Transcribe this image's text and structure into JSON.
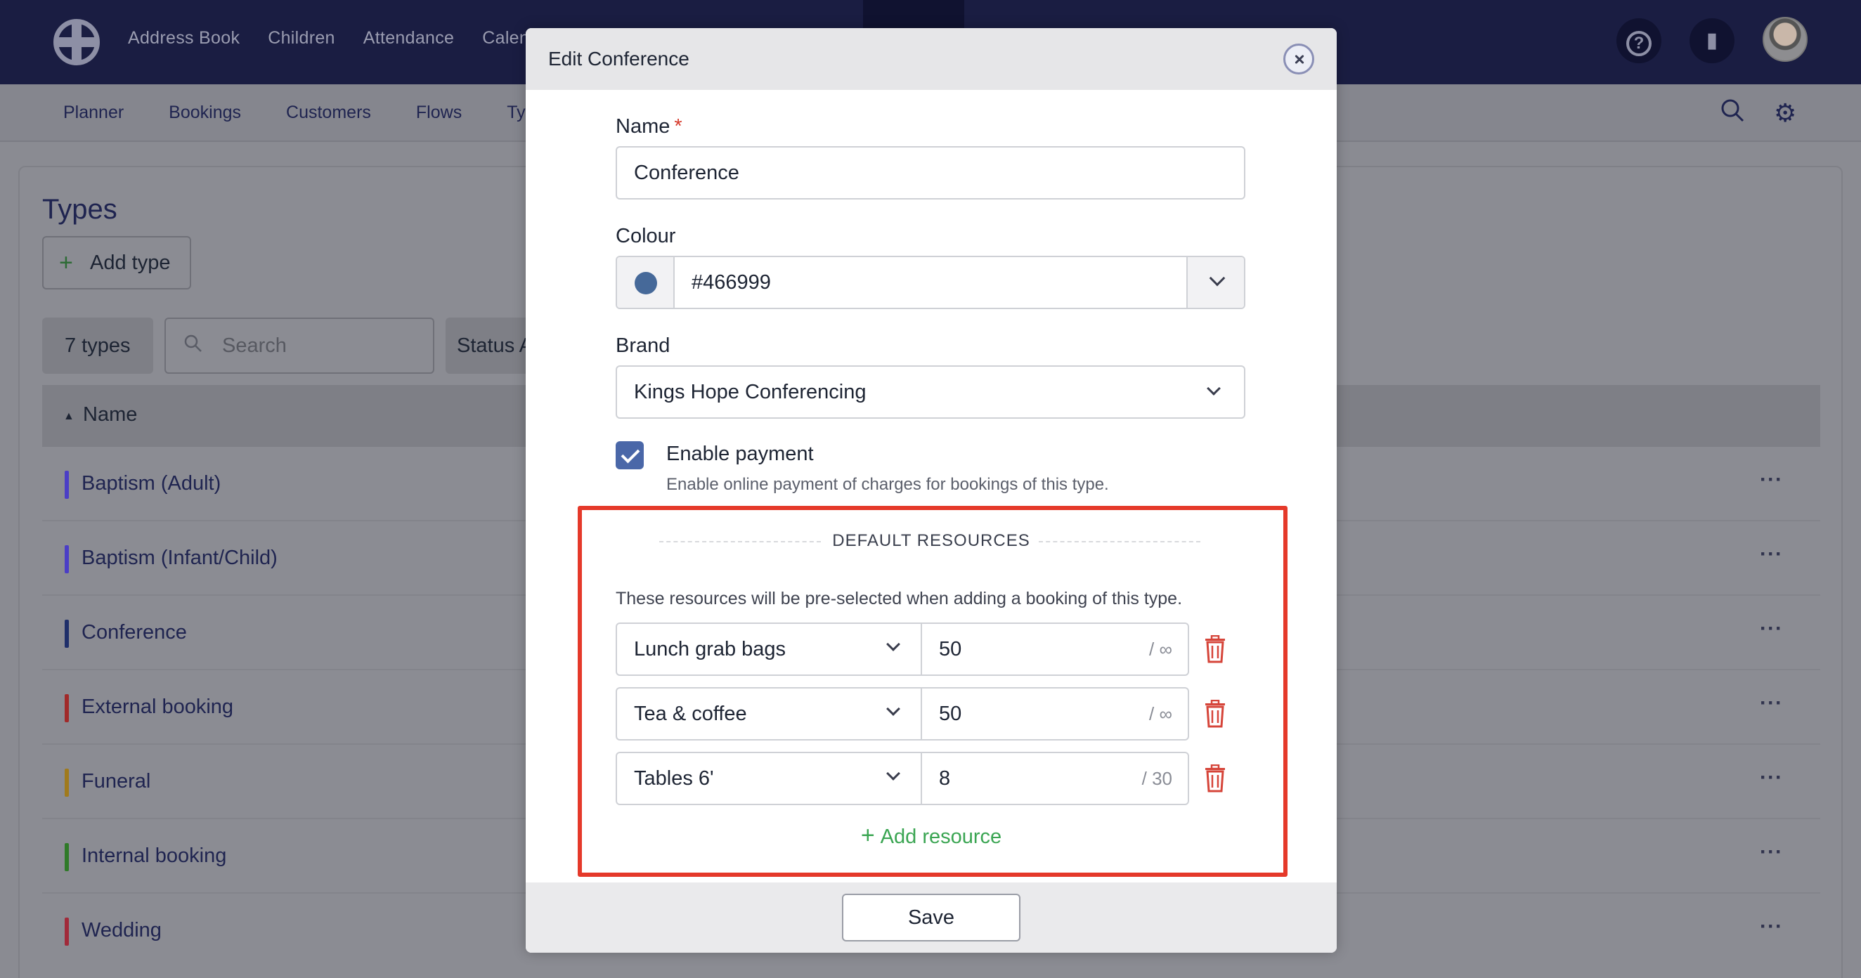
{
  "topnav": {
    "items": [
      "Address Book",
      "Children",
      "Attendance",
      "Calendar"
    ]
  },
  "subnav": {
    "items": [
      "Planner",
      "Bookings",
      "Customers",
      "Flows",
      "Types"
    ]
  },
  "page": {
    "title": "Types",
    "add_button": "Add type",
    "count": "7 types",
    "search_placeholder": "Search",
    "status_filter": "Status All",
    "column_name": "Name",
    "rows": [
      {
        "name": "Baptism (Adult)",
        "color": "#4b3ec6"
      },
      {
        "name": "Baptism (Infant/Child)",
        "color": "#4b3ec6"
      },
      {
        "name": "Conference",
        "color": "#1f2f6a"
      },
      {
        "name": "External booking",
        "color": "#a12a2a"
      },
      {
        "name": "Funeral",
        "color": "#a07a1c"
      },
      {
        "name": "Internal booking",
        "color": "#2f7a28"
      },
      {
        "name": "Wedding",
        "color": "#a12a3a"
      }
    ],
    "more": "···"
  },
  "modal": {
    "title": "Edit Conference",
    "name_label": "Name",
    "required_mark": "*",
    "name_value": "Conference",
    "colour_label": "Colour",
    "colour_value": "#466999",
    "brand_label": "Brand",
    "brand_value": "Kings Hope Conferencing",
    "payment_label": "Enable payment",
    "payment_checked": true,
    "payment_help": "Enable online payment of charges for bookings of this type.",
    "section_title": "DEFAULT RESOURCES",
    "section_desc": "These resources will be pre-selected when adding a booking of this type.",
    "resources": [
      {
        "name": "Lunch grab bags",
        "qty": "50",
        "max": "/ ∞"
      },
      {
        "name": "Tea & coffee",
        "qty": "50",
        "max": "/ ∞"
      },
      {
        "name": "Tables 6'",
        "qty": "8",
        "max": "/ 30"
      }
    ],
    "add_resource": "Add resource",
    "save": "Save"
  },
  "colors": {
    "accent": "#4a67a8",
    "highlight": "#e5392a",
    "add_green": "#3aa552",
    "delete_red": "#d6453a"
  }
}
